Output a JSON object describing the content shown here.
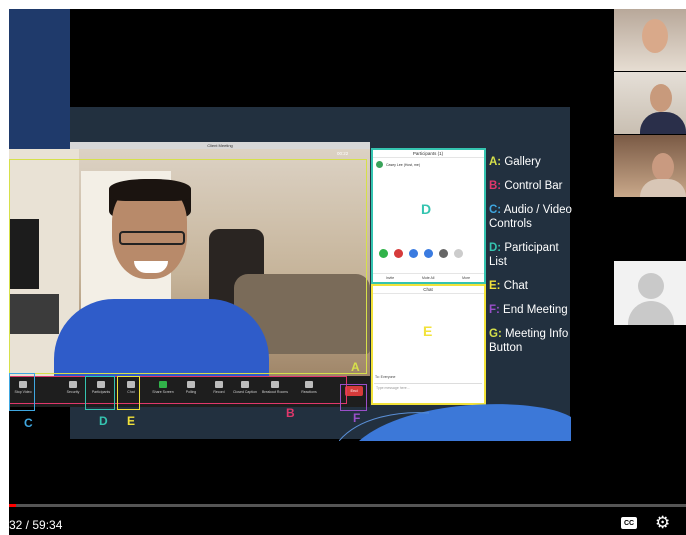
{
  "zoom": {
    "window_title": "Client Meeting",
    "timer": "00:22",
    "control_bar": [
      {
        "label": "Stop Video",
        "icon": "video-icon"
      },
      {
        "label": "Security",
        "icon": "shield-icon"
      },
      {
        "label": "Participants",
        "icon": "participants-icon"
      },
      {
        "label": "Chat",
        "icon": "chat-icon"
      },
      {
        "label": "Share Screen",
        "icon": "share-screen-icon"
      },
      {
        "label": "Polling",
        "icon": "polling-icon"
      },
      {
        "label": "Record",
        "icon": "record-icon"
      },
      {
        "label": "Closed Caption",
        "icon": "cc-icon"
      },
      {
        "label": "Breakout Rooms",
        "icon": "breakout-icon"
      },
      {
        "label": "Reactions",
        "icon": "reactions-icon"
      }
    ],
    "end_label": "End",
    "participants": {
      "title": "Participants (1)",
      "host_name": "Casey Lee (Host, me)",
      "actions": [
        "Invite",
        "Mute All",
        "More"
      ],
      "big_letter": "D"
    },
    "chat": {
      "title": "Chat",
      "to": "To: Everyone",
      "placeholder": "Type message here...",
      "big_letter": "E"
    },
    "callout_letters": {
      "a": "A",
      "b": "B",
      "c": "C",
      "d": "D",
      "e": "E",
      "f": "F"
    }
  },
  "legend": [
    {
      "key": "A:",
      "text": " Gallery",
      "color": "#d6e04a"
    },
    {
      "key": "B:",
      "text": " Control Bar",
      "color": "#e0376b"
    },
    {
      "key": "C:",
      "text": " Audio / Video Controls",
      "color": "#3fa7e0"
    },
    {
      "key": "D:",
      "text": " Participant List",
      "color": "#35c4b0"
    },
    {
      "key": "E:",
      "text": " Chat",
      "color": "#f2e23a"
    },
    {
      "key": "F:",
      "text": " End Meeting",
      "color": "#9a4fc9"
    },
    {
      "key": "G:",
      "text": " Meeting Info Button",
      "color": "#d6e04a"
    }
  ],
  "player": {
    "time": "32 / 59:34",
    "cc_label": "CC",
    "progress": 0.01
  }
}
